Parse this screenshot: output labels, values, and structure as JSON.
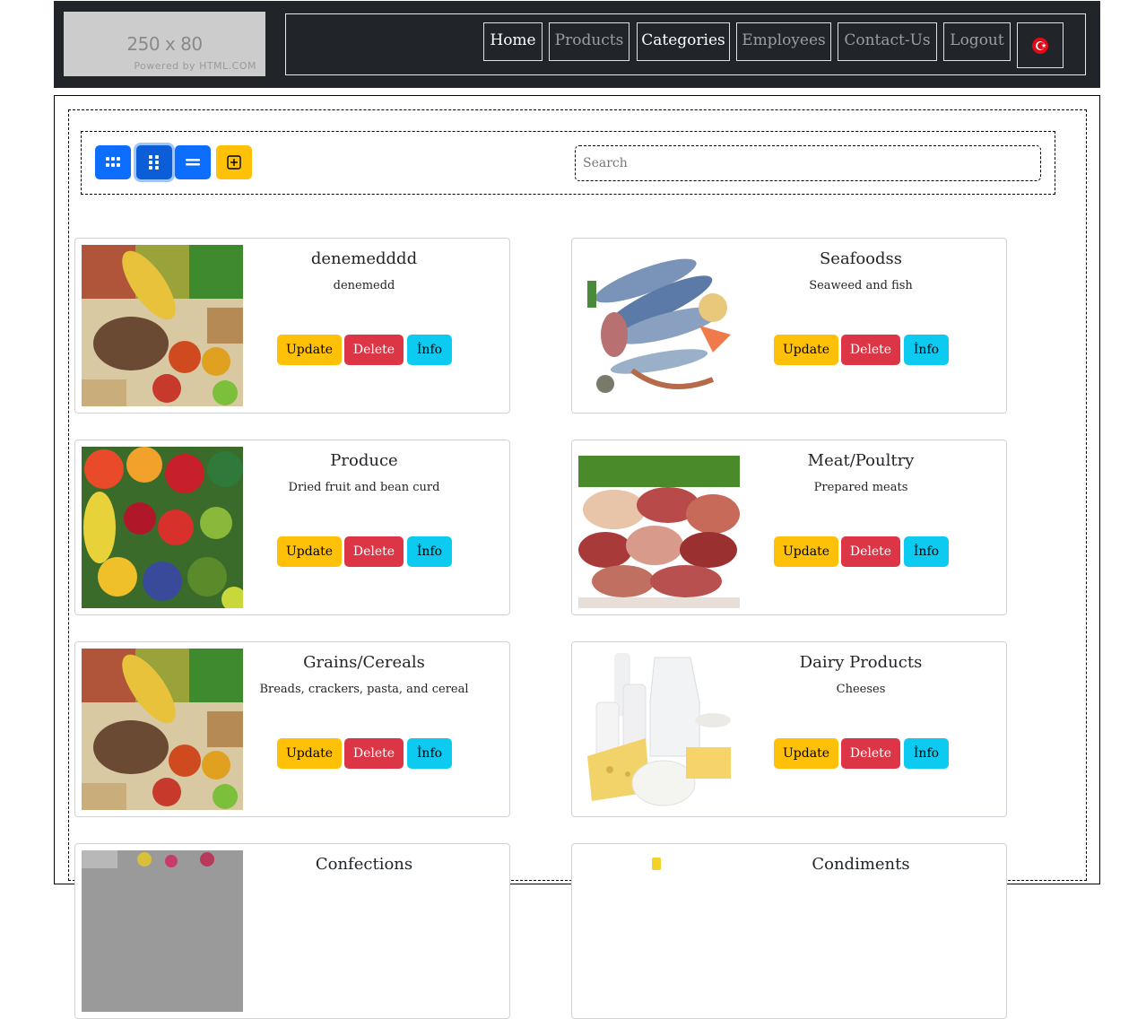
{
  "logo": {
    "size_text": "250 x 80",
    "powered_text": "Powered by HTML.COM"
  },
  "nav": {
    "home": "Home",
    "products": "Products",
    "categories": "Categories",
    "employees": "Employees",
    "contact": "Contact-Us",
    "logout": "Logout",
    "language_icon": "turkey-flag-icon"
  },
  "toolbar": {
    "view_buttons": [
      "grid-small-icon",
      "grid-large-icon",
      "list-icon",
      "add-icon"
    ],
    "search_placeholder": "Search"
  },
  "cards": [
    {
      "title": "denemedddd",
      "description": "denemedd",
      "image": "mixed-produce"
    },
    {
      "title": "Seafoodss",
      "description": "Seaweed and fish",
      "image": "seafood"
    },
    {
      "title": "Produce",
      "description": "Dried fruit and bean curd",
      "image": "vegetables"
    },
    {
      "title": "Meat/Poultry",
      "description": "Prepared meats",
      "image": "meat"
    },
    {
      "title": "Grains/Cereals",
      "description": "Breads, crackers, pasta, and cereal",
      "image": "mixed-produce"
    },
    {
      "title": "Dairy Products",
      "description": "Cheeses",
      "image": "dairy"
    },
    {
      "title": "Confections",
      "description": "",
      "image": "confections"
    },
    {
      "title": "Condiments",
      "description": "",
      "image": "condiments"
    }
  ],
  "card_buttons": {
    "update": "Update",
    "delete": "Delete",
    "info": "İnfo"
  },
  "colors": {
    "navbar": "#212529",
    "primary": "#0d6efd",
    "warning": "#ffc107",
    "danger": "#dc3545",
    "info": "#0dcaf0"
  }
}
